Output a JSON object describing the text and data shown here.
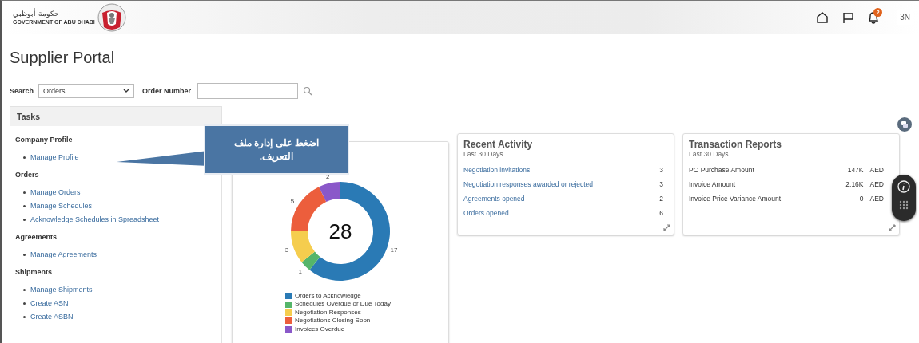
{
  "header": {
    "logo_arabic": "حكومة أبوظبي",
    "logo_text": "GOVERNMENT OF ABU DHABI",
    "notification_count": "2",
    "user_initials": "3N"
  },
  "page_title": "Supplier Portal",
  "search": {
    "label": "Search",
    "value": "Orders",
    "field_label": "Order Number"
  },
  "tasks": {
    "title": "Tasks",
    "sections": [
      {
        "title": "Company Profile",
        "links": [
          "Manage Profile"
        ]
      },
      {
        "title": "Orders",
        "links": [
          "Manage Orders",
          "Manage Schedules",
          "Acknowledge Schedules in Spreadsheet"
        ]
      },
      {
        "title": "Agreements",
        "links": [
          "Manage Agreements"
        ]
      },
      {
        "title": "Shipments",
        "links": [
          "Manage Shipments",
          "Create ASN",
          "Create ASBN"
        ]
      }
    ]
  },
  "callout": {
    "text": "اضغط على إدارة ملف التعريف."
  },
  "summary_chart": {
    "total": "28",
    "chart_data": {
      "type": "donut",
      "categories": [
        "Orders to Acknowledge",
        "Schedules Overdue or Due Today",
        "Negotiation Responses",
        "Negotiations Closing Soon",
        "Invoices Overdue"
      ],
      "values": [
        17,
        1,
        3,
        5,
        2
      ],
      "colors": [
        "#2a7ab5",
        "#55b56a",
        "#f5cd4e",
        "#ec5e3c",
        "#8a58c9"
      ],
      "data_labels": true
    }
  },
  "recent_activity": {
    "title": "Recent Activity",
    "subtitle": "Last 30 Days",
    "rows": [
      {
        "label": "Negotiation invitations",
        "count": "3"
      },
      {
        "label": "Negotiation responses awarded or rejected",
        "count": "3"
      },
      {
        "label": "Agreements opened",
        "count": "2"
      },
      {
        "label": "Orders opened",
        "count": "6"
      }
    ]
  },
  "transaction_reports": {
    "title": "Transaction Reports",
    "subtitle": "Last 30 Days",
    "rows": [
      {
        "label": "PO Purchase Amount",
        "amount": "147K",
        "currency": "AED"
      },
      {
        "label": "Invoice Amount",
        "amount": "2.16K",
        "currency": "AED"
      },
      {
        "label": "Invoice Price Variance Amount",
        "amount": "0",
        "currency": "AED"
      }
    ]
  }
}
